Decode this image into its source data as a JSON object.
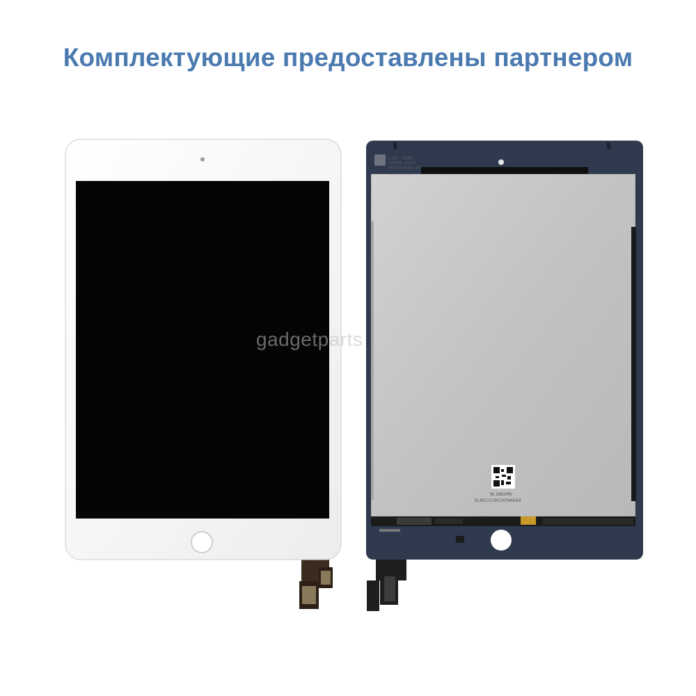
{
  "heading": "Комплектующие предоставлены партнером",
  "watermark": "gadgetparts",
  "back_panel": {
    "top_label_line1": "L18C-4380",
    "top_label_line2": "20054-2426",
    "top_label_line3": "0977X0628-03",
    "bottom_label_line1": "NL1N8XMA",
    "bottom_label_line2": "DLN5151002XFW0669"
  },
  "colors": {
    "heading": "#4a7ab0",
    "front_bezel": "#f6f6f6",
    "screen": "#050505",
    "back_frame": "#2f3a4f",
    "back_plate": "#c9c9c9"
  }
}
